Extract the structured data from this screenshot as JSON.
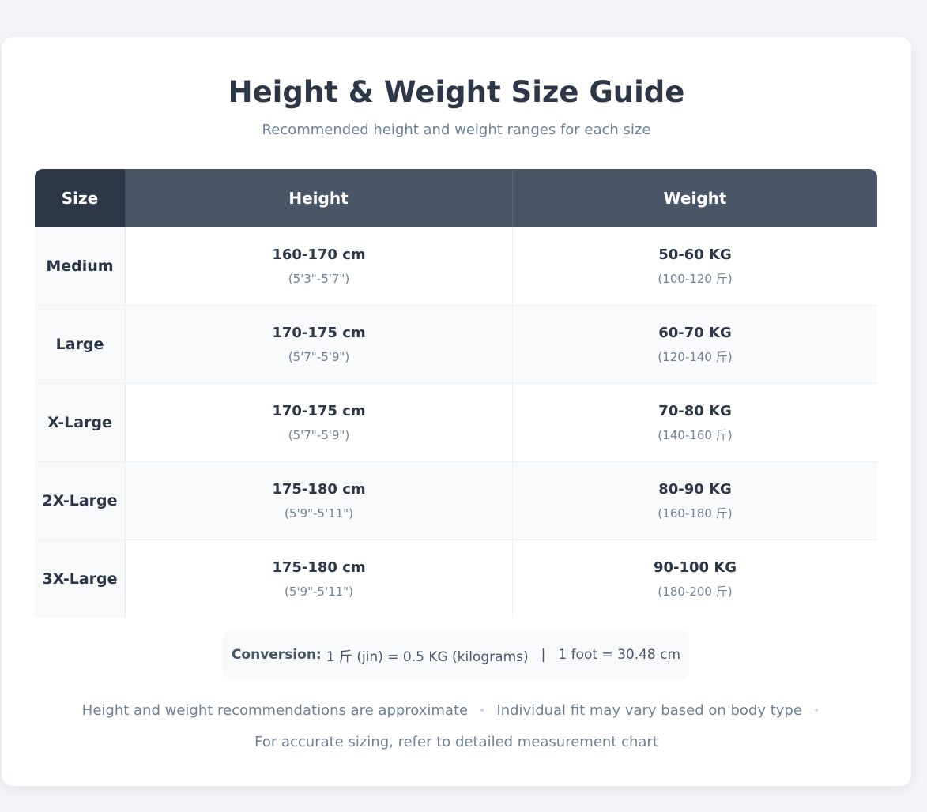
{
  "title": "Height & Weight Size Guide",
  "subtitle": "Recommended height and weight ranges for each size",
  "table": {
    "headers": {
      "size": "Size",
      "height": "Height",
      "weight": "Weight"
    },
    "rows": [
      {
        "size": "Medium",
        "height_cm": "160-170 cm",
        "height_ft": "(5'3\"-5'7\")",
        "weight_kg": "50-60 KG",
        "weight_jin": "(100-120 斤)"
      },
      {
        "size": "Large",
        "height_cm": "170-175 cm",
        "height_ft": "(5'7\"-5'9\")",
        "weight_kg": "60-70 KG",
        "weight_jin": "(120-140 斤)"
      },
      {
        "size": "X-Large",
        "height_cm": "170-175 cm",
        "height_ft": "(5'7\"-5'9\")",
        "weight_kg": "70-80 KG",
        "weight_jin": "(140-160 斤)"
      },
      {
        "size": "2X-Large",
        "height_cm": "175-180 cm",
        "height_ft": "(5'9\"-5'11\")",
        "weight_kg": "80-90 KG",
        "weight_jin": "(160-180 斤)"
      },
      {
        "size": "3X-Large",
        "height_cm": "175-180 cm",
        "height_ft": "(5'9\"-5'11\")",
        "weight_kg": "90-100 KG",
        "weight_jin": "(180-200 斤)"
      }
    ]
  },
  "conversion": {
    "label": "Conversion:",
    "jin_text": "1 斤 (jin) = 0.5 KG (kilograms)",
    "separator": "|",
    "foot_text": "1 foot = 30.48 cm"
  },
  "notes": {
    "note1": "Height and weight recommendations are approximate",
    "note2": "Individual fit may vary based on body type",
    "note3": "For accurate sizing, refer to detailed measurement chart",
    "bullet": "•"
  }
}
